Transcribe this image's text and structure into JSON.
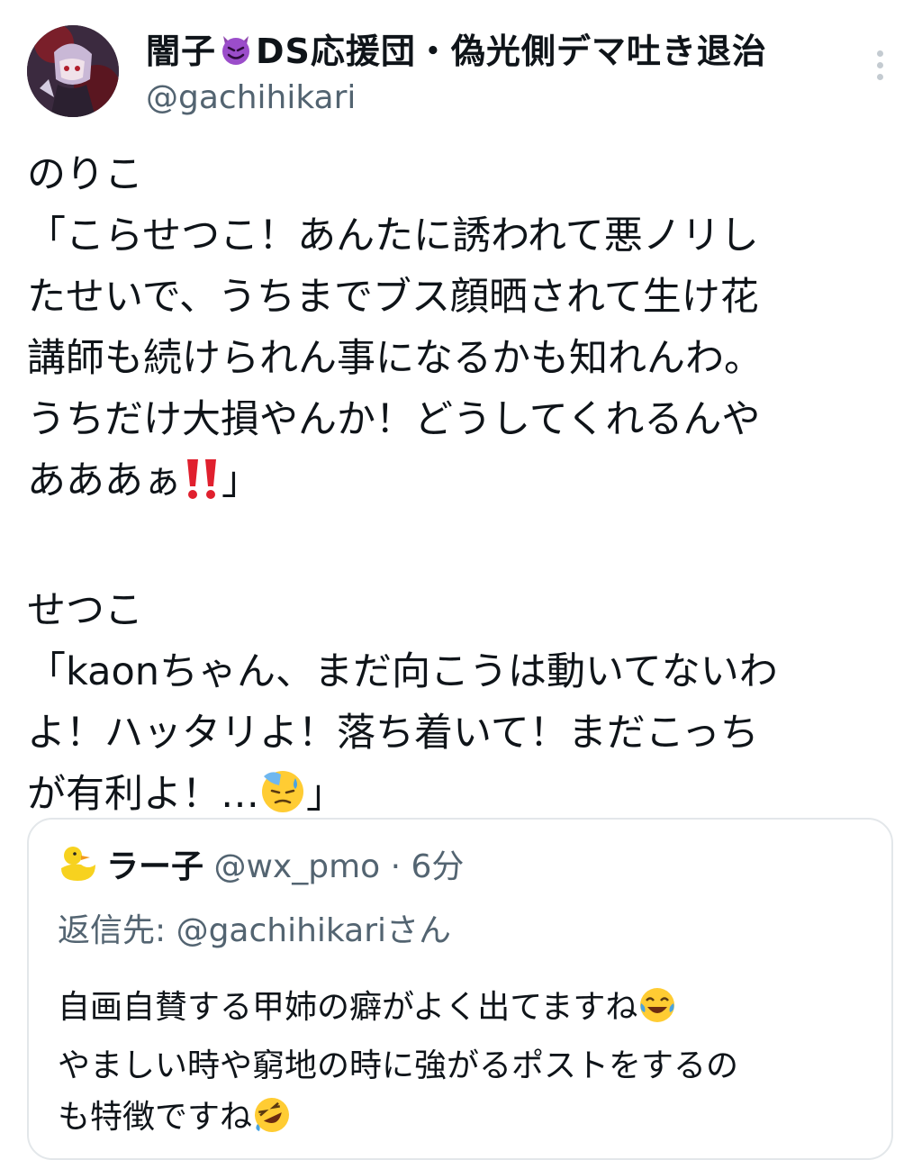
{
  "tweet": {
    "display_name_part1": "闇子",
    "display_name_part2": "DS応援団・偽光側デマ吐き退治",
    "handle": "@gachihikari",
    "speaker1": "のりこ",
    "line1": "「こらせつこ！あんたに誘われて悪ノリし",
    "line2": "たせいで、うちまでブス顔晒されて生け花",
    "line3": "講師も続けられん事になるかも知れんわ。",
    "line4": "うちだけ大損やんか！どうしてくれるんや",
    "line5a": "あああぁ",
    "line5b": "」",
    "speaker2": "せつこ",
    "line6": "「kaonちゃん、まだ向こうは動いてないわ",
    "line7": "よ！ハッタリよ！落ち着いて！まだこっち",
    "line8a": "が有利よ！…",
    "line8b": "」"
  },
  "quote": {
    "name": "ラー子",
    "handle_time": "@wx_pmo · 6分",
    "reply_to": "返信先: @gachihikariさん",
    "body_line1": "自画自賛する甲姉の癖がよく出てますね",
    "body_line2": "やましい時や窮地の時に強がるポストをするの",
    "body_line3": "も特徴ですね"
  },
  "colors": {
    "text": "#0f1419",
    "secondary": "#536471",
    "border": "#e3e7ea",
    "accent_red": "#e0202e"
  }
}
